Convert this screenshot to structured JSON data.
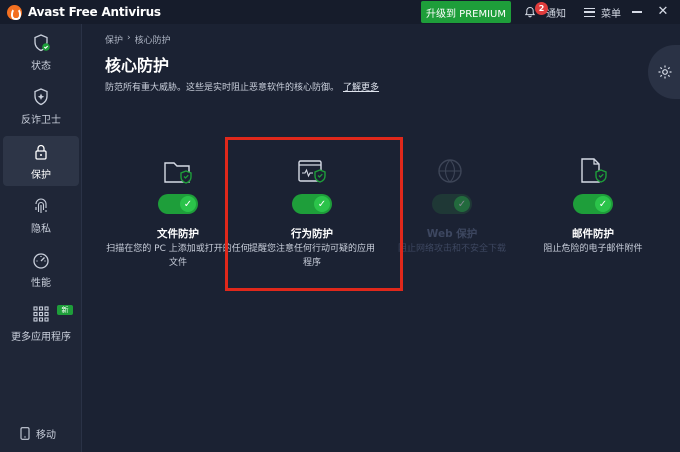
{
  "titlebar": {
    "app_title": "Avast Free Antivirus",
    "upgrade_label": "升级到 PREMIUM",
    "notifications_count": "2",
    "notifications_label": "通知",
    "menu_label": "菜单",
    "close_glyph": "✕"
  },
  "sidebar": {
    "items": [
      {
        "label": "状态",
        "icon": "shield-check-icon"
      },
      {
        "label": "反诈卫士",
        "icon": "fraud-shield-icon"
      },
      {
        "label": "保护",
        "icon": "lock-icon"
      },
      {
        "label": "隐私",
        "icon": "fingerprint-icon"
      },
      {
        "label": "性能",
        "icon": "speedometer-icon"
      },
      {
        "label": "更多应用程序",
        "icon": "apps-grid-icon"
      }
    ],
    "new_badge": "新",
    "mobile_label": "移动"
  },
  "main": {
    "breadcrumb": [
      "保护",
      "›",
      "核心防护"
    ],
    "title": "核心防护",
    "description": "防范所有重大威胁。这些是实时阻止恶意软件的核心防御。",
    "learn_more": "了解更多",
    "shields": [
      {
        "title": "文件防护",
        "desc": "扫描在您的 PC 上添加或打开的任何文件",
        "enabled": true
      },
      {
        "title": "行为防护",
        "desc": "提醒您注意任何行动可疑的应用程序",
        "enabled": true
      },
      {
        "title": "Web 保护",
        "desc": "阻止网络攻击和不安全下载",
        "enabled": true
      },
      {
        "title": "邮件防护",
        "desc": "阻止危险的电子邮件附件",
        "enabled": true
      }
    ]
  },
  "colors": {
    "background": "#1b2233",
    "accent_green": "#1e9e3a",
    "highlight_red": "#e0281b"
  }
}
